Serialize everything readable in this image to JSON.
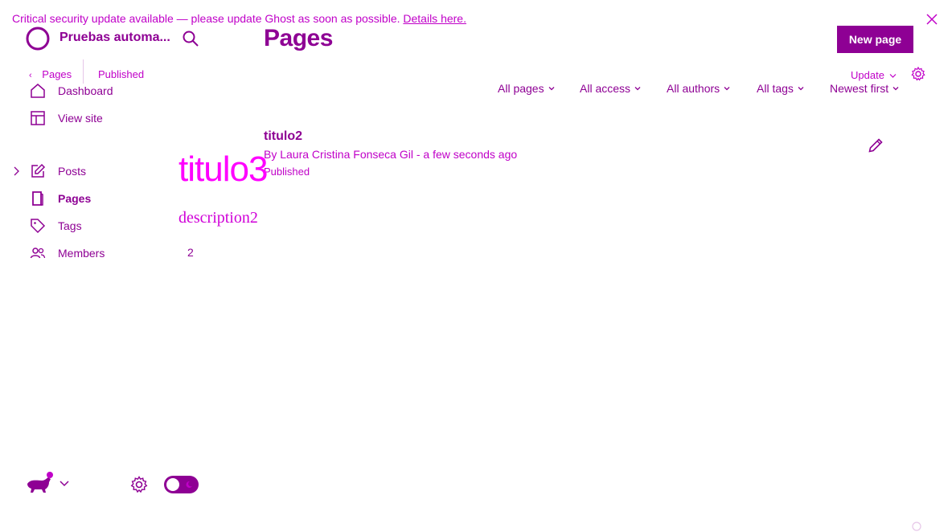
{
  "banner": {
    "message": "Critical security update available — please update Ghost as soon as possible.",
    "link": "Details here."
  },
  "sidebar": {
    "site_title": "Pruebas automa...",
    "items": [
      {
        "label": "Dashboard",
        "icon": "home-icon"
      },
      {
        "label": "View site",
        "icon": "layout-icon"
      },
      {
        "label": "Posts",
        "icon": "edit-icon"
      },
      {
        "label": "Pages",
        "icon": "page-icon"
      },
      {
        "label": "Tags",
        "icon": "tag-icon"
      },
      {
        "label": "Members",
        "icon": "members-icon"
      }
    ]
  },
  "editor_header": {
    "back_label": "Pages",
    "status": "Published",
    "update_label": "Update"
  },
  "main": {
    "title": "Pages",
    "new_button": "New page",
    "filters": [
      "All pages",
      "All access",
      "All authors",
      "All tags",
      "Newest first"
    ],
    "list": [
      {
        "title": "titulo2",
        "meta": "By Laura Cristina Fonseca Gil - a few seconds ago",
        "status": "Published"
      }
    ]
  },
  "overlay": {
    "title": "titulo3",
    "description": "description2",
    "count": "2"
  },
  "colors": {
    "brand": "#8e0094",
    "accent": "#ff00ff",
    "light": "#c000c8"
  }
}
